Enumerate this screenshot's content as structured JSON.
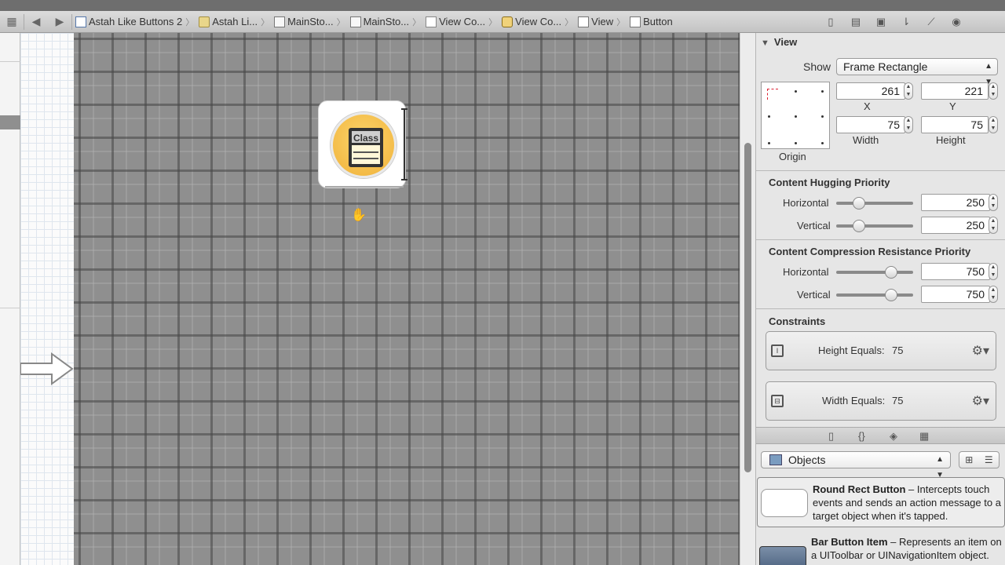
{
  "jumpbar": {
    "crumbs": [
      {
        "label": "Astah Like Buttons 2",
        "icon": "project-file-icon"
      },
      {
        "label": "Astah Li...",
        "icon": "folder-icon"
      },
      {
        "label": "MainSto...",
        "icon": "storyboard-icon"
      },
      {
        "label": "MainSto...",
        "icon": "storyboard-icon"
      },
      {
        "label": "View Co...",
        "icon": "view-controller-scene-icon"
      },
      {
        "label": "View Co...",
        "icon": "view-controller-icon"
      },
      {
        "label": "View",
        "icon": "view-icon"
      },
      {
        "label": "Button",
        "icon": "button-icon"
      }
    ]
  },
  "canvas": {
    "button_label": "Class"
  },
  "inspector": {
    "view_section": "View",
    "show_label": "Show",
    "show_value": "Frame Rectangle",
    "origin_label": "Origin",
    "x_value": "261",
    "x_label": "X",
    "y_value": "221",
    "y_label": "Y",
    "width_value": "75",
    "width_label": "Width",
    "height_value": "75",
    "height_label": "Height",
    "hugging_title": "Content Hugging Priority",
    "hugging_h_label": "Horizontal",
    "hugging_h_value": "250",
    "hugging_v_label": "Vertical",
    "hugging_v_value": "250",
    "compression_title": "Content Compression Resistance Priority",
    "compression_h_label": "Horizontal",
    "compression_h_value": "750",
    "compression_v_label": "Vertical",
    "compression_v_value": "750",
    "hugging_fraction": 0.25,
    "compression_fraction": 0.75,
    "constraints_title": "Constraints",
    "constraints": [
      {
        "label": "Height Equals:",
        "value": "75"
      },
      {
        "label": "Width Equals:",
        "value": "75"
      }
    ]
  },
  "library": {
    "filter_value": "Objects",
    "items": [
      {
        "name": "Round Rect Button",
        "desc": " – Intercepts touch events and sends an action message to a target object when it's tapped."
      },
      {
        "name": "Bar Button Item",
        "desc": " – Represents an item on a UIToolbar or UINavigationItem object."
      }
    ]
  }
}
